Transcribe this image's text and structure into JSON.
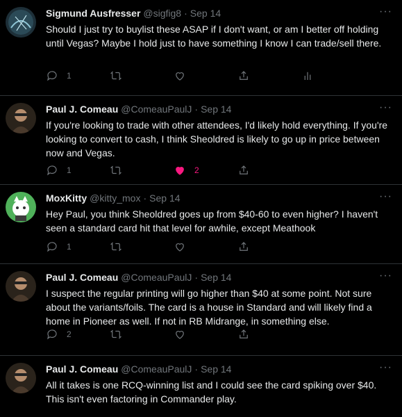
{
  "tweets": [
    {
      "name": "Sigmund Ausfresser",
      "handle": "@sigfig8",
      "date": "Sep 14",
      "text": "Should I just try to buylist these ASAP if I don't want, or am I better off holding until Vegas? Maybe I hold just to have something I know I can trade/sell there.",
      "replies": "1",
      "retweets": "",
      "likes": "",
      "liked": false,
      "show_analytics": true,
      "avatar_color": "#2b4a57"
    },
    {
      "name": "Paul J. Comeau",
      "handle": "@ComeauPaulJ",
      "date": "Sep 14",
      "text": "If you're looking to trade with other attendees, I'd likely hold everything. If you're looking to convert to cash, I think Sheoldred is likely to go up in price between now and Vegas.",
      "replies": "1",
      "retweets": "",
      "likes": "2",
      "liked": true,
      "show_analytics": false,
      "avatar_color": "#3c2f23"
    },
    {
      "name": "MoxKitty",
      "handle": "@kitty_mox",
      "date": "Sep 14",
      "text": "Hey Paul, you think Sheoldred goes up from $40-60 to even higher? I haven't seen a standard card hit that level for awhile, except Meathook",
      "replies": "1",
      "retweets": "",
      "likes": "",
      "liked": false,
      "show_analytics": false,
      "avatar_color": "#4fb15a"
    },
    {
      "name": "Paul J. Comeau",
      "handle": "@ComeauPaulJ",
      "date": "Sep 14",
      "text": "I suspect the regular printing will go higher than $40 at some point. Not sure about the variants/foils. The card is a house in Standard and will likely find a home in Pioneer as well. If not in RB Midrange, in something else.",
      "replies": "2",
      "retweets": "",
      "likes": "",
      "liked": false,
      "show_analytics": false,
      "avatar_color": "#3c2f23"
    },
    {
      "name": "Paul J. Comeau",
      "handle": "@ComeauPaulJ",
      "date": "Sep 14",
      "text": "All it takes is one RCQ-winning list and I could see the card spiking over $40. This isn't even factoring in Commander play.",
      "replies": "",
      "retweets": "",
      "likes": "",
      "liked": false,
      "show_analytics": false,
      "avatar_color": "#3c2f23"
    }
  ],
  "ui": {
    "dot": "·",
    "more": "···"
  },
  "colors": {
    "background": "#000000",
    "text": "#e7e9ea",
    "muted": "#71767b",
    "like": "#f91880",
    "border": "#2f3336"
  }
}
